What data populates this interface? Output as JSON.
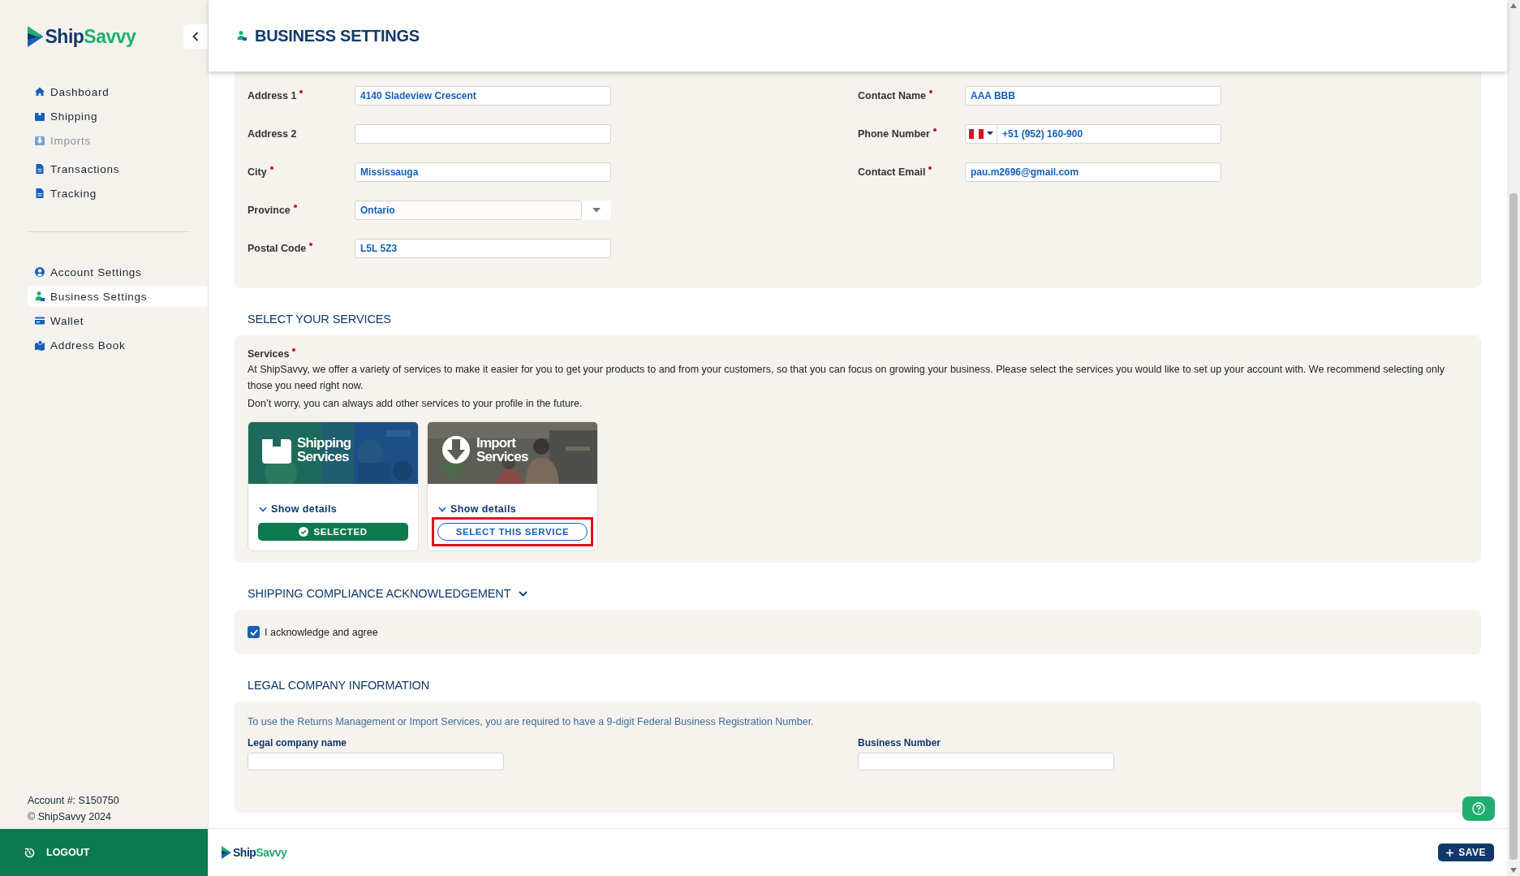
{
  "sidebar": {
    "logo": {
      "part_1": "Ship",
      "part_2": "Savvy"
    },
    "nav_groups": [
      {
        "items": [
          {
            "label": "Dashboard",
            "selected": false,
            "disabled": false
          },
          {
            "label": "Shipping",
            "selected": false,
            "disabled": false
          },
          {
            "label": "Imports",
            "selected": false,
            "disabled": true
          },
          {
            "label": "Transactions",
            "selected": false,
            "disabled": false
          },
          {
            "label": "Tracking",
            "selected": false,
            "disabled": false
          }
        ]
      },
      {
        "items": [
          {
            "label": "Account Settings",
            "selected": false,
            "disabled": false
          },
          {
            "label": "Business Settings",
            "selected": true,
            "disabled": false
          },
          {
            "label": "Wallet",
            "selected": false,
            "disabled": false
          },
          {
            "label": "Address Book",
            "selected": false,
            "disabled": false
          }
        ]
      }
    ],
    "account": "Account #: S150750",
    "copyright": "© ShipSavvy 2024",
    "logout": "LOGOUT"
  },
  "header": {
    "title": "BUSINESS SETTINGS"
  },
  "mailing_address": {
    "columns": [
      {
        "fields": [
          {
            "kind": "text",
            "label": "Address 1",
            "required": true,
            "value": "4140 Sladeview Crescent"
          },
          {
            "kind": "text",
            "label": "Address 2",
            "required": false
          },
          {
            "kind": "text",
            "label": "City",
            "required": true,
            "value": "Mississauga"
          },
          {
            "kind": "select",
            "label": "Province",
            "required": true,
            "value": "Ontario"
          },
          {
            "kind": "text",
            "label": "Postal Code",
            "required": true,
            "value": "L5L 5Z3"
          }
        ]
      },
      {
        "fields": [
          {
            "kind": "text",
            "label": "Contact Name",
            "required": true,
            "value": "AAA BBB"
          },
          {
            "kind": "phone",
            "label": "Phone Number",
            "required": true,
            "value": "+51 (952) 160-900"
          },
          {
            "kind": "text",
            "label": "Contact Email",
            "required": true,
            "value": "pau.m2696@gmail.com"
          }
        ]
      }
    ]
  },
  "services": {
    "heading": "SELECT YOUR SERVICES",
    "label": "Services",
    "required": true,
    "description": [
      "At ShipSavvy, we offer a variety of services to make it easier for you to get your products to and from your customers, so that you can focus on growing your business. Please select the services you would like to set up your account with. We recommend selecting only those you need right now.",
      "Don’t worry, you can always add other services to your profile in the future."
    ],
    "cards": [
      {
        "kind": "shipping",
        "title": "Shipping Services",
        "details": "Show details",
        "action": "SELECTED",
        "selected": true,
        "highlighted": false
      },
      {
        "kind": "import",
        "title": "Import Services",
        "details": "Show details",
        "action": "SELECT THIS SERVICE",
        "selected": false,
        "highlighted": true
      }
    ]
  },
  "compliance": {
    "heading": "SHIPPING COMPLIANCE ACKNOWLEDGEMENT",
    "expanded": true,
    "checkbox": {
      "label": "I acknowledge and agree",
      "checked": true
    }
  },
  "legal": {
    "heading": "LEGAL COMPANY INFORMATION",
    "note": "To use the Returns Management or Import Services, you are required to have a 9-digit Federal Business Registration Number.",
    "fields": [
      {
        "label": "Legal company name"
      },
      {
        "label": "Business Number"
      }
    ]
  },
  "footer": {
    "logo": {
      "part_1": "Ship",
      "part_2": "Savvy"
    },
    "save": "SAVE"
  }
}
